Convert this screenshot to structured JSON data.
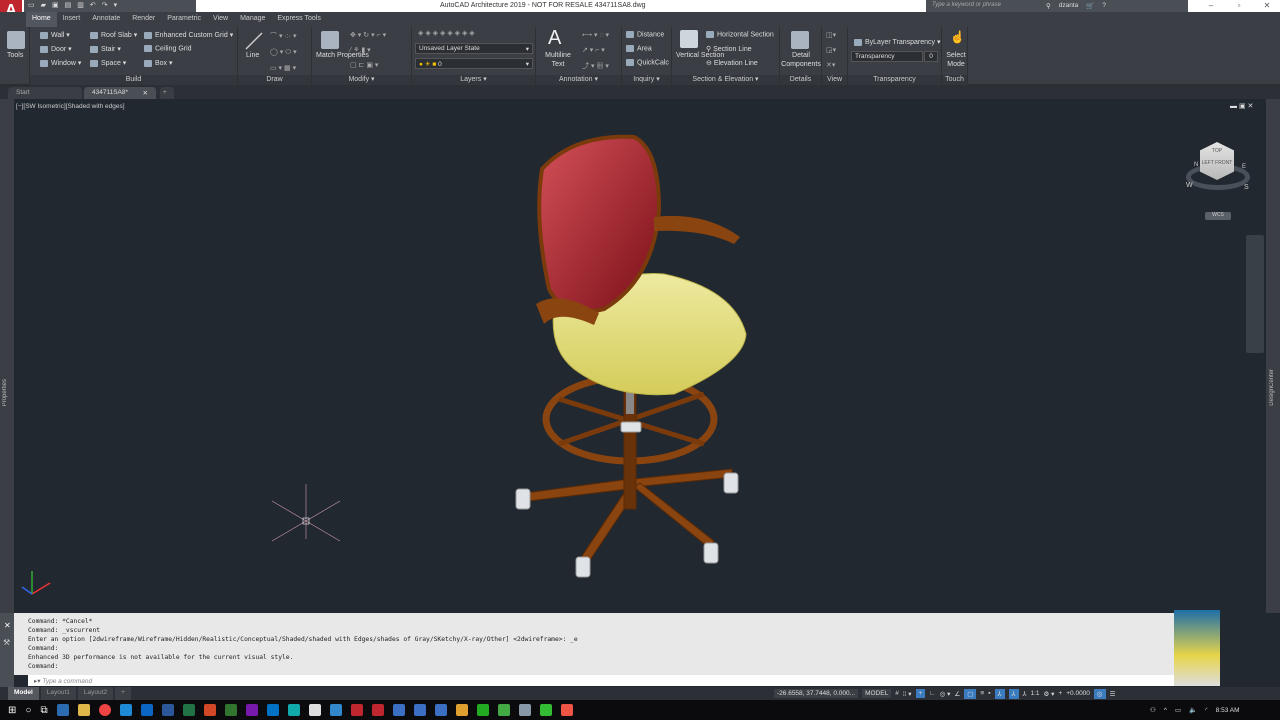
{
  "app": {
    "logo": "A",
    "title": "AutoCAD Architecture 2019 - NOT FOR RESALE   434711SA8.dwg",
    "search_placeholder": "Type a keyword or phrase",
    "user": "dzanta"
  },
  "ribbon_tabs": [
    "Home",
    "Insert",
    "Annotate",
    "Render",
    "Parametric",
    "View",
    "Manage",
    "Express Tools"
  ],
  "ribbon": {
    "tools": "Tools",
    "build": {
      "title": "Build",
      "items": [
        "Wall",
        "Door",
        "Window",
        "Roof Slab",
        "Stair",
        "Space",
        "Enhanced Custom Grid",
        "Ceiling Grid",
        "Box"
      ]
    },
    "draw": {
      "title": "Draw",
      "line": "Line"
    },
    "modify": {
      "title": "Modify",
      "match": "Match Properties"
    },
    "layers": {
      "title": "Layers",
      "layer_state": "Unsaved Layer State",
      "layer": "0"
    },
    "annotation": {
      "title": "Annotation",
      "multiline": "Multiline Text"
    },
    "inquiry": {
      "title": "Inquiry",
      "items": [
        "Distance",
        "Area",
        "QuickCalc"
      ]
    },
    "section": {
      "title": "Section & Elevation",
      "vertical": "Vertical Section",
      "items": [
        "Horizontal Section",
        "Section Line",
        "Elevation Line"
      ]
    },
    "details": {
      "title": "Details",
      "detail": "Detail Components"
    },
    "view": {
      "title": "View"
    },
    "transparency": {
      "title": "Transparency",
      "bylayer": "ByLayer Transparency",
      "field": "Transparency",
      "value": "0"
    },
    "touch": {
      "title": "Touch",
      "select": "Select Mode"
    }
  },
  "file_tabs": [
    "Start",
    "434711SA8*"
  ],
  "viewport": {
    "label": "[−][SW Isometric][Shaded with edges]",
    "viewcube": {
      "top": "TOP",
      "left": "LEFT",
      "front": "FRONT",
      "n": "N",
      "w": "W",
      "s": "S",
      "e": "E",
      "wcs": "WCS"
    }
  },
  "palettes": {
    "left": "Properties",
    "right": "DesignCenter"
  },
  "command_history": [
    "Command: *Cancel*",
    "Command: _vscurrent",
    "Enter an option [2dwireframe/Wireframe/Hidden/Realistic/Conceptual/Shaded/shaded with Edges/shades of Gray/SKetchy/X-ray/Other] <2dwireframe>: _e",
    "Command:",
    "Enhanced 3D performance is not available for the current visual style.",
    "Command:"
  ],
  "command_placeholder": "Type a command",
  "layout_tabs": [
    "Model",
    "Layout1",
    "Layout2"
  ],
  "status": {
    "coords": "-26.6558, 37.7448, 0.000...",
    "model": "MODEL",
    "scale": "1:1",
    "offset": "+0.0000"
  },
  "clock": "8:53 AM",
  "colors": {
    "accent": "#c0262d",
    "viewport": "#212830",
    "seat": "#e6e27a",
    "back": "#9e1b25",
    "wood": "#7a3a0c"
  }
}
